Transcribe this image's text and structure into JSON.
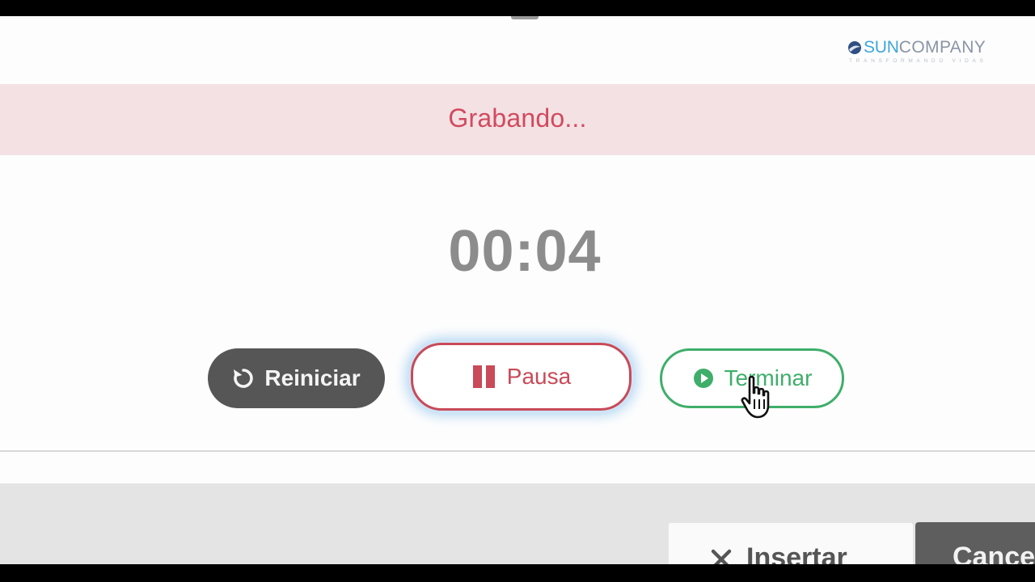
{
  "brand": {
    "name_part1": "SUN",
    "name_part2": "COMPANY",
    "tagline": "TRANSFORMANDO VIDAS"
  },
  "recorder": {
    "status_text": "Grabando...",
    "elapsed_time": "00:04",
    "buttons": {
      "restart_label": "Reiniciar",
      "pause_label": "Pausa",
      "finish_label": "Terminar"
    }
  },
  "footer": {
    "insert_label": "Insertar",
    "cancel_label": "Cance"
  },
  "colors": {
    "recording_red": "#d14a5f",
    "banner_pink": "#f4e1e3",
    "finish_green": "#3fae6a",
    "restart_gray": "#565656",
    "brand_blue": "#3fa6dd"
  },
  "icons": {
    "restart": "restart-icon",
    "pause": "pause-icon",
    "finish": "play-circle-icon",
    "insert": "close-icon"
  }
}
